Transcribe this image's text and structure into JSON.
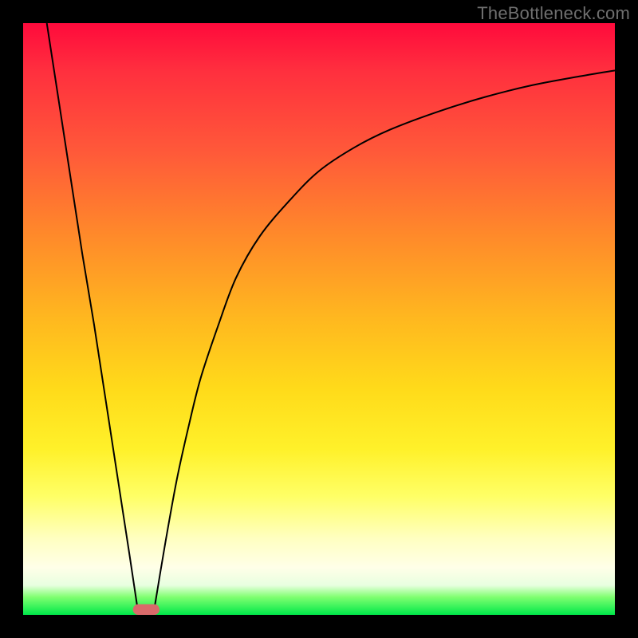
{
  "watermark": "TheBottleneck.com",
  "colors": {
    "frame": "#000000",
    "gradient_top": "#ff0a3c",
    "gradient_bottom": "#00e84a",
    "curve": "#000000",
    "marker": "#d96a6a",
    "watermark_text": "#6f6f6f"
  },
  "chart_data": {
    "type": "line",
    "title": "",
    "xlabel": "",
    "ylabel": "",
    "xlim": [
      0,
      100
    ],
    "ylim": [
      0,
      100
    ],
    "grid": false,
    "legend": false,
    "series": [
      {
        "name": "left-branch",
        "x": [
          4,
          6,
          8,
          10,
          12,
          14,
          16,
          18,
          19.5
        ],
        "values": [
          100,
          87,
          74,
          61,
          49,
          36,
          23,
          10,
          0
        ]
      },
      {
        "name": "right-branch",
        "x": [
          22,
          24,
          26,
          28,
          30,
          33,
          36,
          40,
          45,
          50,
          56,
          62,
          70,
          78,
          86,
          94,
          100
        ],
        "values": [
          0,
          12,
          23,
          32,
          40,
          49,
          57,
          64,
          70,
          75,
          79,
          82,
          85,
          87.5,
          89.5,
          91,
          92
        ]
      }
    ],
    "marker": {
      "x_center": 20.8,
      "width": 4.5,
      "y": 0,
      "height": 1.8
    },
    "annotations": []
  }
}
